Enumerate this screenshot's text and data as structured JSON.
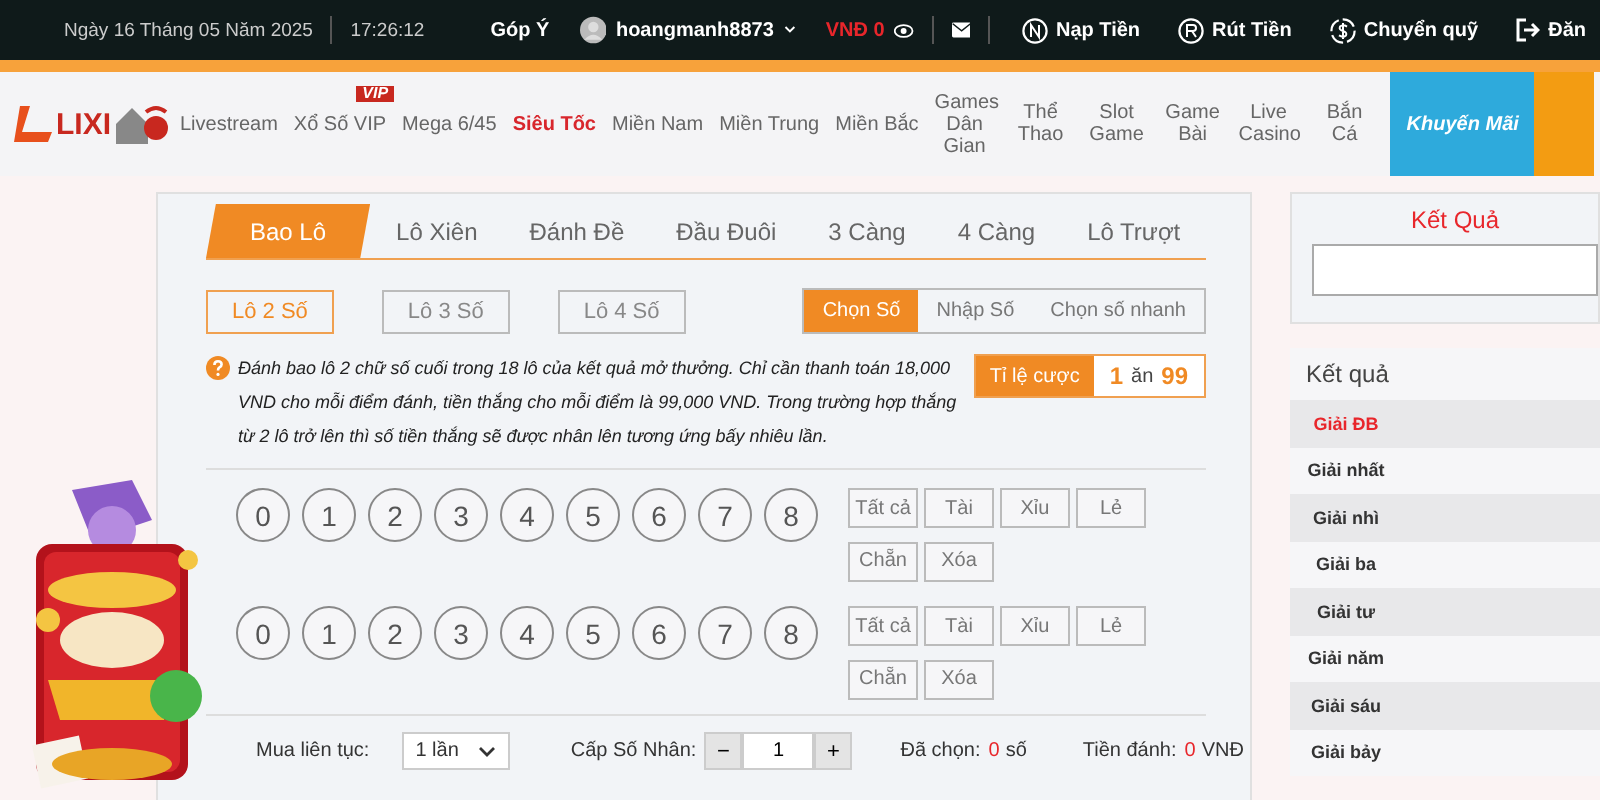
{
  "header": {
    "date": "Ngày 16 Tháng 05 Năm 2025",
    "time": "17:26:12",
    "feedback": "Góp Ý",
    "username": "hoangmanh8873",
    "balance": "VNĐ 0",
    "links": [
      {
        "kind": "deposit",
        "label": "Nạp Tiền"
      },
      {
        "kind": "withdraw",
        "label": "Rút Tiền"
      },
      {
        "kind": "transfer",
        "label": "Chuyển quỹ"
      },
      {
        "kind": "logout",
        "label": "Đăn"
      }
    ]
  },
  "nav": {
    "logo": "LIXI",
    "items": [
      {
        "label": "Livestream",
        "selected": false
      },
      {
        "label": "Xổ Số VIP",
        "selected": false,
        "badge": "VIP"
      },
      {
        "label": "Mega 6/45",
        "selected": false
      },
      {
        "label": "Siêu Tốc",
        "selected": true
      },
      {
        "label": "Miền Nam",
        "selected": false
      },
      {
        "label": "Miền Trung",
        "selected": false
      },
      {
        "label": "Miền Bắc",
        "selected": false
      },
      {
        "label": "Games Dân Gian",
        "selected": false
      },
      {
        "label": "Thể Thao",
        "selected": false
      },
      {
        "label": "Slot Game",
        "selected": false
      },
      {
        "label": "Game Bài",
        "selected": false
      },
      {
        "label": "Live Casino",
        "selected": false
      },
      {
        "label": "Bắn Cá",
        "selected": false
      }
    ],
    "promo": "Khuyến Mãi"
  },
  "tabs": [
    {
      "label": "Bao Lô",
      "selected": true
    },
    {
      "label": "Lô Xiên",
      "selected": false
    },
    {
      "label": "Đánh Đề",
      "selected": false
    },
    {
      "label": "Đầu Đuôi",
      "selected": false
    },
    {
      "label": "3 Càng",
      "selected": false
    },
    {
      "label": "4 Càng",
      "selected": false
    },
    {
      "label": "Lô Trượt",
      "selected": false
    }
  ],
  "subtabs": [
    {
      "label": "Lô 2 Số",
      "selected": true
    },
    {
      "label": "Lô 3 Số",
      "selected": false
    },
    {
      "label": "Lô 4 Số",
      "selected": false
    }
  ],
  "modes": [
    {
      "label": "Chọn Số",
      "selected": true
    },
    {
      "label": "Nhập Số",
      "selected": false
    },
    {
      "label": "Chọn số nhanh",
      "selected": false
    }
  ],
  "description": "Đánh bao lô 2 chữ số cuối trong 18 lô của kết quả mở thưởng. Chỉ cần thanh toán 18,000 VND cho mỗi điểm đánh, tiền thắng cho mỗi điểm là 99,000 VND. Trong trường hợp thắng từ 2 lô trở lên thì số tiền thắng sẽ được nhân lên tương ứng bấy nhiêu lần.",
  "odds": {
    "label": "Tỉ lệ cược",
    "stake": "1",
    "word": "ăn",
    "payout": "99"
  },
  "rows": [
    {
      "numbers": [
        "0",
        "1",
        "2",
        "3",
        "4",
        "5",
        "6",
        "7",
        "8"
      ],
      "quick": [
        "Tất cả",
        "Tài",
        "Xỉu",
        "Lẻ",
        "Chẵn",
        "Xóa"
      ]
    },
    {
      "numbers": [
        "0",
        "1",
        "2",
        "3",
        "4",
        "5",
        "6",
        "7",
        "8"
      ],
      "quick": [
        "Tất cả",
        "Tài",
        "Xỉu",
        "Lẻ",
        "Chẵn",
        "Xóa"
      ]
    }
  ],
  "footer": {
    "repeat_label": "Mua liên tục:",
    "repeat_value": "1 lần",
    "multiplier_label": "Cấp Số Nhân:",
    "minus": "−",
    "multiplier": "1",
    "plus": "+",
    "chosen_label": "Đã chọn:",
    "chosen": "0",
    "chosen_unit": "số",
    "amount_label": "Tiền đánh:",
    "amount": "0",
    "amount_unit": "VNĐ"
  },
  "sidebar": {
    "title": "Kết Quả",
    "list_title": "Kết quả",
    "prizes": [
      {
        "label": "Giải ĐB",
        "highlight": true
      },
      {
        "label": "Giải nhất",
        "highlight": false
      },
      {
        "label": "Giải nhì",
        "highlight": false
      },
      {
        "label": "Giải ba",
        "highlight": false
      },
      {
        "label": "Giải tư",
        "highlight": false
      },
      {
        "label": "Giải năm",
        "highlight": false
      },
      {
        "label": "Giải sáu",
        "highlight": false
      },
      {
        "label": "Giải bảy",
        "highlight": false
      }
    ]
  }
}
